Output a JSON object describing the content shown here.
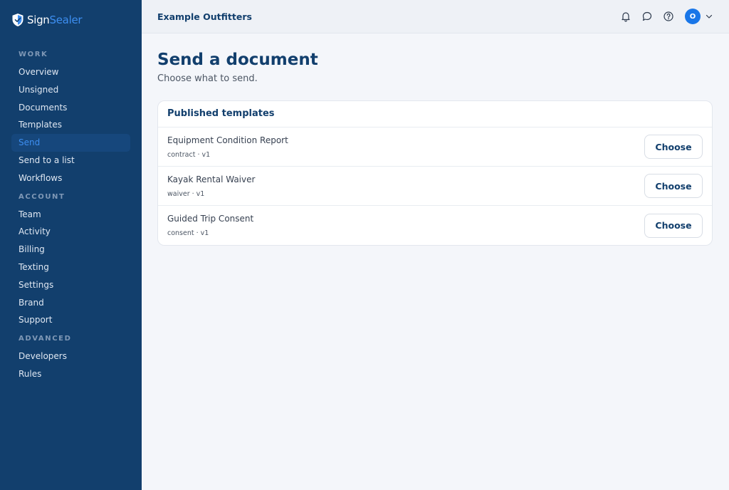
{
  "brand": {
    "name_part1": "Sign",
    "name_part2": "Sealer",
    "logo_icon": "shield-icon"
  },
  "colors": {
    "sidebar_bg": "#123f6d",
    "accent": "#3d8ef0",
    "avatar_bg": "#1976e8",
    "title": "#123f6d"
  },
  "sidebar": {
    "sections": [
      {
        "label": "WORK",
        "items": [
          {
            "label": "Overview",
            "active": false
          },
          {
            "label": "Unsigned",
            "active": false
          },
          {
            "label": "Documents",
            "active": false
          },
          {
            "label": "Templates",
            "active": false
          },
          {
            "label": "Send",
            "active": true
          },
          {
            "label": "Send to a list",
            "active": false
          },
          {
            "label": "Workflows",
            "active": false
          }
        ]
      },
      {
        "label": "ACCOUNT",
        "items": [
          {
            "label": "Team",
            "active": false
          },
          {
            "label": "Activity",
            "active": false
          },
          {
            "label": "Billing",
            "active": false
          },
          {
            "label": "Texting",
            "active": false
          },
          {
            "label": "Settings",
            "active": false
          },
          {
            "label": "Brand",
            "active": false
          },
          {
            "label": "Support",
            "active": false
          }
        ]
      },
      {
        "label": "ADVANCED",
        "items": [
          {
            "label": "Developers",
            "active": false
          },
          {
            "label": "Rules",
            "active": false
          }
        ]
      }
    ]
  },
  "header": {
    "org_name": "Example Outfitters",
    "icons": [
      "bell-icon",
      "chat-icon",
      "help-icon"
    ],
    "avatar_initial": "O"
  },
  "page": {
    "title": "Send a document",
    "subtitle": "Choose what to send."
  },
  "templates_card": {
    "title": "Published templates",
    "rows": [
      {
        "name": "Equipment Condition Report",
        "meta": "contract · v1",
        "button": "Choose"
      },
      {
        "name": "Kayak Rental Waiver",
        "meta": "waiver · v1",
        "button": "Choose"
      },
      {
        "name": "Guided Trip Consent",
        "meta": "consent · v1",
        "button": "Choose"
      }
    ]
  }
}
